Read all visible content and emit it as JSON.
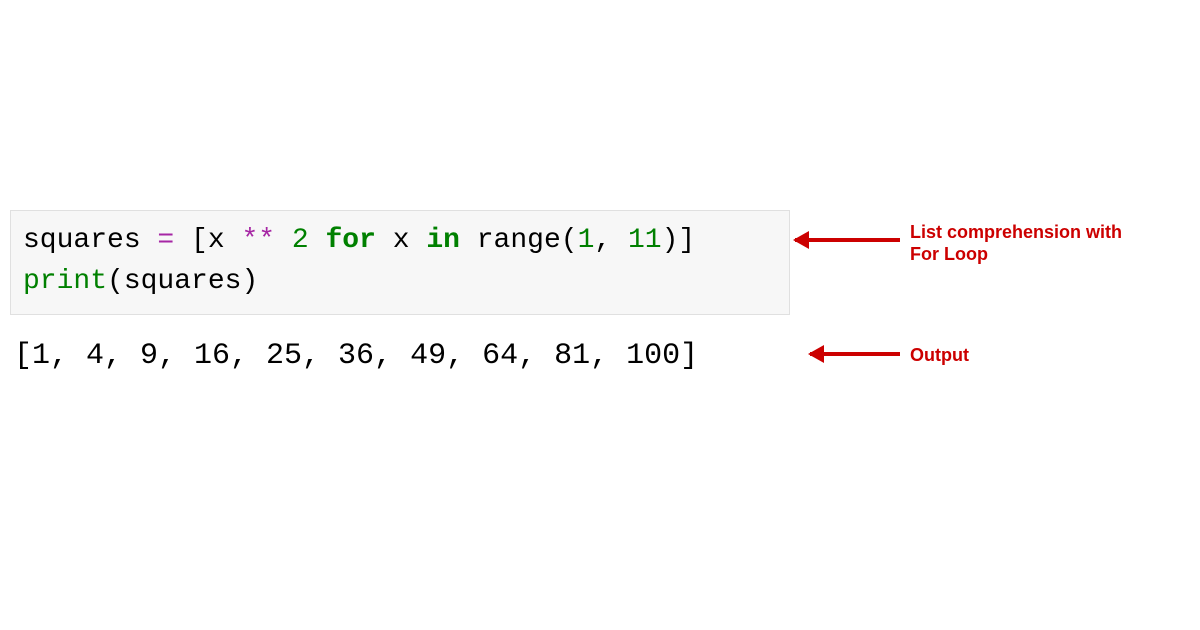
{
  "code": {
    "line1": {
      "t0": "squares ",
      "t1": "=",
      "t2": " [x ",
      "t3": "**",
      "t4": " ",
      "t5": "2",
      "t6": " ",
      "t7": "for",
      "t8": " x ",
      "t9": "in",
      "t10": " range(",
      "t11": "1",
      "t12": ", ",
      "t13": "11",
      "t14": ")]"
    },
    "line2": {
      "t0": "print",
      "t1": "(squares)"
    }
  },
  "output": "[1, 4, 9, 16, 25, 36, 49, 64, 81, 100]",
  "annotations": {
    "listComp": "List comprehension with For Loop",
    "output": "Output"
  }
}
